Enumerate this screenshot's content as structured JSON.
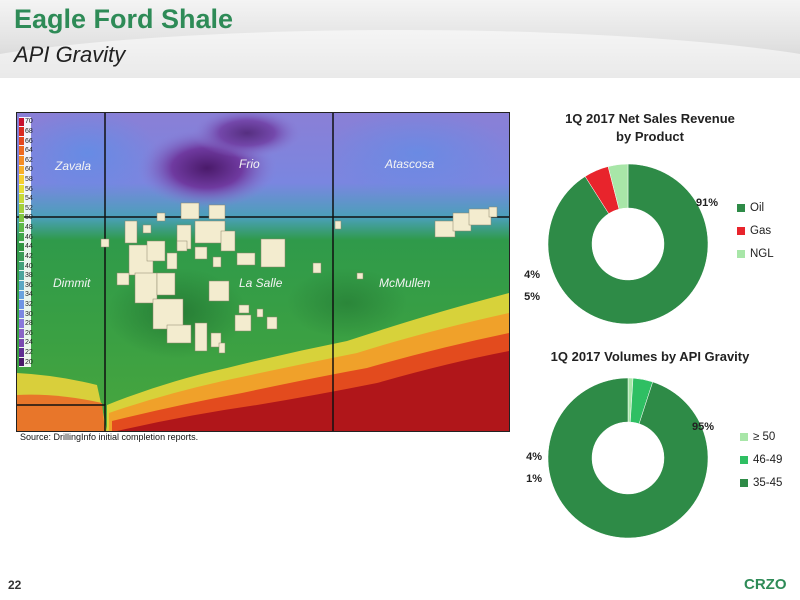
{
  "slide": {
    "title": "Eagle Ford Shale",
    "subtitle": "API Gravity",
    "page_number": "22",
    "logo": "CRZO"
  },
  "map": {
    "scale_ticks": [
      "70",
      "68",
      "66",
      "64",
      "62",
      "60",
      "58",
      "56",
      "54",
      "52",
      "50",
      "48",
      "46",
      "44",
      "42",
      "40",
      "38",
      "36",
      "34",
      "32",
      "30",
      "28",
      "26",
      "24",
      "22",
      "20"
    ],
    "counties": [
      "Zavala",
      "Frio",
      "Atascosa",
      "Dimmit",
      "La Salle",
      "McMullen"
    ],
    "source": "Source:  DrillingInfo initial completion reports."
  },
  "chart_data": [
    {
      "type": "pie",
      "title_lines": [
        "1Q 2017 Net Sales Revenue",
        "by Product"
      ],
      "categories": [
        "Oil",
        "Gas",
        "NGL"
      ],
      "values": [
        91,
        5,
        4
      ],
      "data_labels": [
        "91%",
        "5%",
        "4%"
      ],
      "colors": [
        "#2e8b47",
        "#e8242c",
        "#a8e6a8"
      ],
      "legend": "right",
      "donut": true
    },
    {
      "type": "pie",
      "title_lines": [
        "1Q 2017 Volumes by API Gravity"
      ],
      "categories": [
        "≥ 50",
        "46-49",
        "35-45"
      ],
      "values": [
        1,
        4,
        95
      ],
      "data_labels": [
        "1%",
        "4%",
        "95%"
      ],
      "colors": [
        "#a8e6a8",
        "#2fbf63",
        "#2e8b47"
      ],
      "legend": "right",
      "donut": true
    }
  ]
}
